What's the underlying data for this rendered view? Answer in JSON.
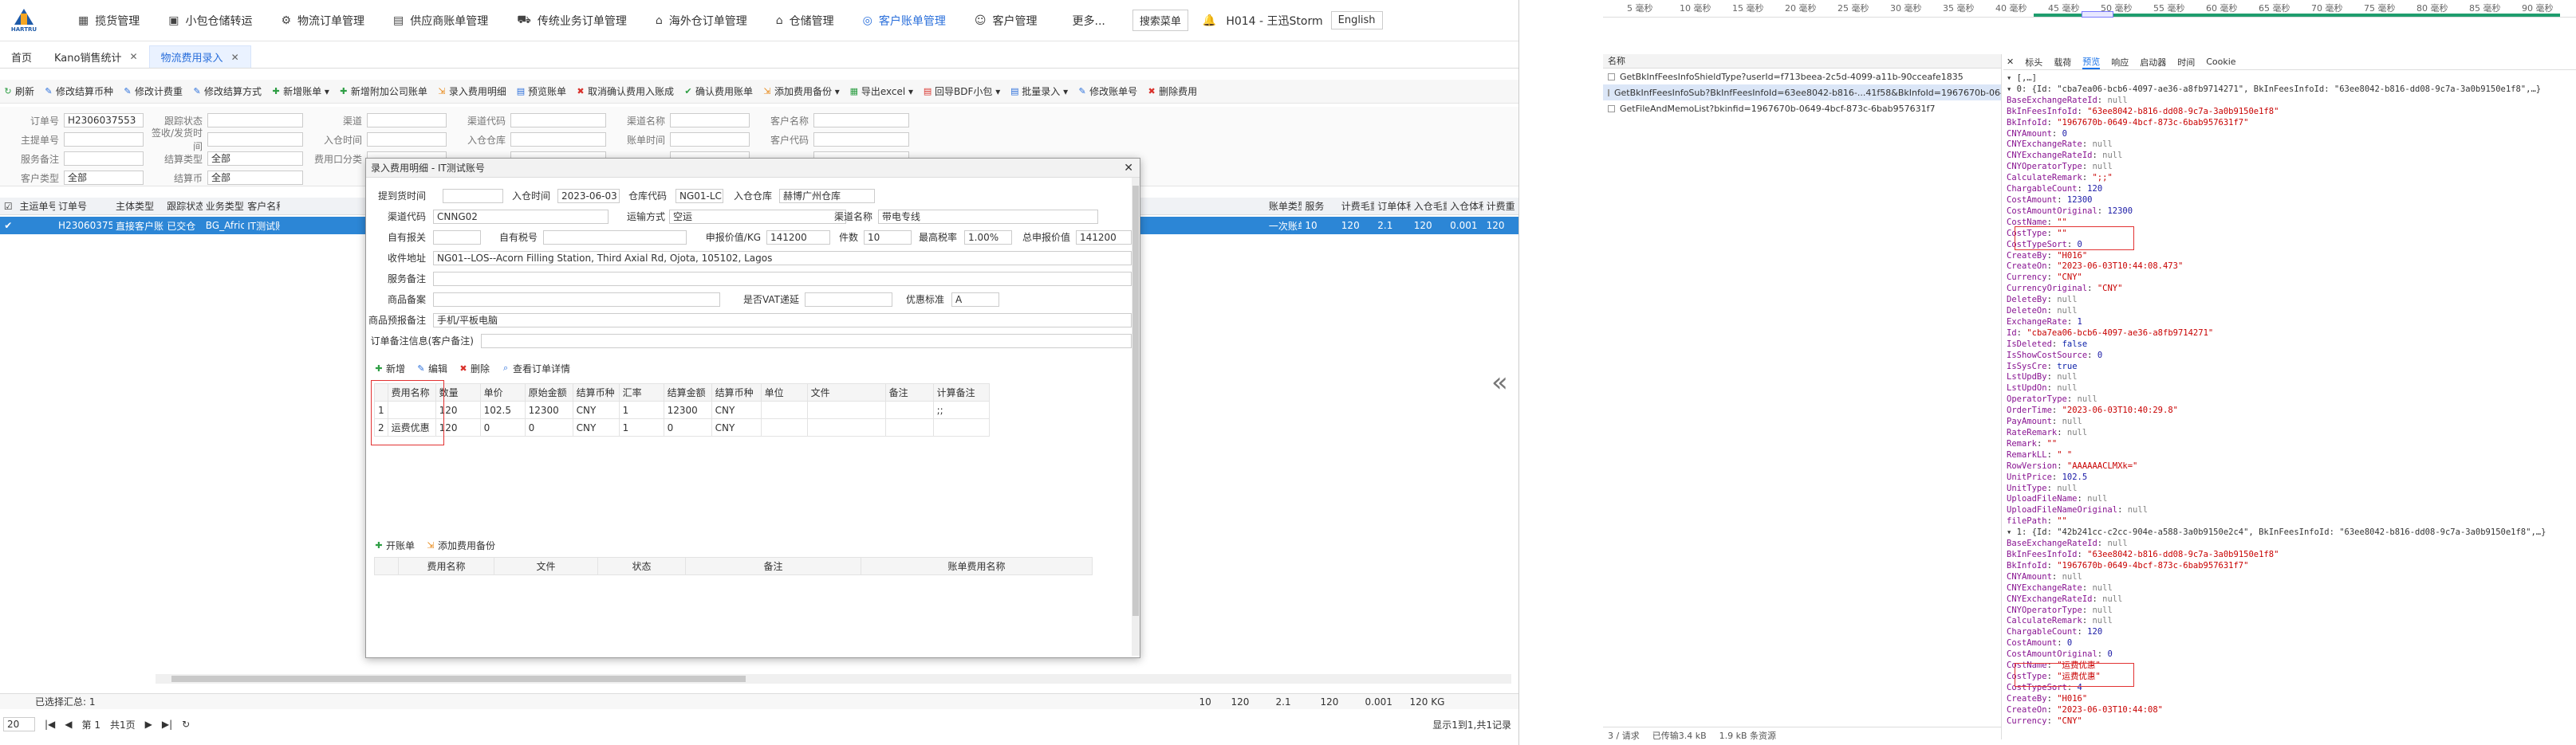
{
  "topnav": {
    "logo_text": "HARTRU",
    "items": [
      {
        "icon": "grid-icon",
        "label": "揽货管理"
      },
      {
        "icon": "warehouse-icon",
        "label": "小包仓储转运"
      },
      {
        "icon": "gear-icon",
        "label": "物流订单管理"
      },
      {
        "icon": "document-icon",
        "label": "供应商账单管理"
      },
      {
        "icon": "truck-icon",
        "label": "传统业务订单管理"
      },
      {
        "icon": "home-icon",
        "label": "海外仓订单管理"
      },
      {
        "icon": "house-icon",
        "label": "仓储管理"
      },
      {
        "icon": "compass-icon",
        "label": "客户账单管理"
      },
      {
        "icon": "users-icon",
        "label": "客户管理"
      },
      {
        "icon": "more-icon",
        "label": "更多..."
      }
    ],
    "active_index": 7,
    "search_menu": "搜索菜单",
    "bell": "bell-icon",
    "user": "H014 - 王迅Storm",
    "language": "English"
  },
  "tabs": [
    {
      "label": "首页"
    },
    {
      "label": "Kano销售统计",
      "close": "✕"
    },
    {
      "label": "物流费用录入",
      "close": "✕",
      "active": true
    }
  ],
  "toolbar": [
    {
      "icon": "refresh-icon",
      "label": "刷新"
    },
    {
      "icon": "edit-icon",
      "label": "修改结算币种"
    },
    {
      "icon": "edit-icon",
      "label": "修改计费重"
    },
    {
      "icon": "edit-icon",
      "label": "修改结算方式"
    },
    {
      "icon": "add-icon",
      "label": "新增账单 ▾"
    },
    {
      "icon": "add-icon",
      "label": "新增附加公司账单"
    },
    {
      "icon": "import-icon",
      "label": "录入费用明细"
    },
    {
      "icon": "preview-icon",
      "label": "预览账单"
    },
    {
      "icon": "cancel-icon",
      "label": "取消确认费用入账成"
    },
    {
      "icon": "check-icon",
      "label": "确认费用账单"
    },
    {
      "icon": "import-icon",
      "label": "添加费用备份 ▾"
    },
    {
      "icon": "excel-icon",
      "label": "导出excel ▾"
    },
    {
      "icon": "pdf-icon",
      "label": "回导BDF小包 ▾"
    },
    {
      "icon": "batch-icon",
      "label": "批量录入 ▾"
    },
    {
      "icon": "edit-icon",
      "label": "修改账单号"
    },
    {
      "icon": "delete-icon",
      "label": "删除费用"
    }
  ],
  "filters": {
    "row1": [
      {
        "label": "订单号",
        "value": "H2306037553"
      },
      {
        "label": "跟踪状态",
        "value": ""
      },
      {
        "label": "渠道",
        "value": ""
      },
      {
        "label": "渠道代码",
        "value": ""
      },
      {
        "label": "渠道名称",
        "value": ""
      },
      {
        "label": "客户名称",
        "value": ""
      }
    ],
    "row2": [
      {
        "label": "主提单号",
        "value": ""
      },
      {
        "label": "签收/发货时间",
        "value": ""
      },
      {
        "label": "入仓时间",
        "value": ""
      },
      {
        "label": "入仓仓库",
        "value": ""
      },
      {
        "label": "账单时间",
        "value": ""
      },
      {
        "label": "客户代码",
        "value": ""
      }
    ],
    "row3": [
      {
        "label": "服务备注",
        "value": ""
      },
      {
        "label": "结算类型",
        "value": "全部"
      },
      {
        "label": "费用口分类",
        "value": ""
      },
      {
        "label": "",
        "value": ""
      },
      {
        "label": "",
        "value": ""
      },
      {
        "label": "",
        "value": ""
      }
    ],
    "row4": [
      {
        "label": "客户类型",
        "value": "全部"
      },
      {
        "label": "结算币",
        "value": "全部"
      }
    ]
  },
  "grid": {
    "headers": [
      "主运单号",
      "订单号",
      "主体类型",
      "跟踪状态",
      "业务类型",
      "客户名称",
      "",
      "",
      "",
      "",
      "",
      "",
      "",
      "",
      "",
      "",
      "",
      "",
      "",
      "",
      "",
      "",
      "",
      "账单类型",
      "服务",
      "计费毛重",
      "订单体积",
      "入仓毛重",
      "入仓体积",
      "计费重"
    ],
    "row": [
      "",
      "H2306037553",
      "直接客户账单",
      "已交仓",
      "BG_Africa",
      "IT测试账",
      "",
      "",
      "",
      "",
      "",
      "",
      "",
      "",
      "",
      "",
      "",
      "",
      "",
      "",
      "",
      "",
      "",
      "一次账单",
      "10",
      "120",
      "2.1",
      "120",
      "0.001",
      "120"
    ],
    "footer_left": "已选择汇总: 1",
    "footer_vals": [
      "10",
      "120",
      "2.1",
      "120",
      "0.001",
      "120 KG"
    ],
    "page_size": "20",
    "page_label": "第 1",
    "page_total": "共1页",
    "status": "显示1到1,共1记录"
  },
  "dialog": {
    "title": "录入费用明细 - IT测试账号",
    "close": "✕",
    "fields": {
      "pickup_time_label": "提到货时间",
      "pickup_time": "",
      "warehouse_in_time_label": "入仓时间",
      "warehouse_in_time": "2023-06-03",
      "warehouse_code_label": "仓库代码",
      "warehouse_code": "NG01-LC",
      "in_warehouse_label": "入仓仓库",
      "in_warehouse": "赫博广州仓库",
      "channel_code_label": "渠道代码",
      "channel_code": "CNNG02",
      "transport_label": "运输方式",
      "transport": "空运",
      "channel_name_label": "渠道名称",
      "channel_name": "带电专线",
      "self_declare_label": "自有报关",
      "self_declare": "",
      "self_tax_label": "自有税号",
      "self_tax": "",
      "declare_value_label": "申报价值/KG",
      "declare_value": "141200",
      "pieces_label": "件数",
      "pieces": "10",
      "max_tax_label": "最高税率",
      "max_tax": "1.00%",
      "total_declare_label": "总申报价值",
      "total_declare": "141200",
      "address_label": "收件地址",
      "address": "NG01--LOS--Acorn Filling Station, Third Axial Rd, Ojota, 105102, Lagos",
      "service_note_label": "服务备注",
      "service_note": "",
      "goods_note_label": "商品备案",
      "goods_note": "",
      "vat_label": "是否VAT递延",
      "vat": "",
      "discount_label": "优惠标准",
      "discount": "A",
      "goods_remark_label": "商品预报备注",
      "goods_remark": "手机/平板电脑",
      "order_remark_label": "订单备注信息(客户备注)",
      "order_remark": ""
    },
    "sub_toolbar": [
      {
        "icon": "add-icon",
        "label": "新增"
      },
      {
        "icon": "edit-icon",
        "label": "编辑"
      },
      {
        "icon": "delete-icon",
        "label": "删除"
      },
      {
        "icon": "search-icon",
        "label": "查看订单详情"
      }
    ],
    "fee_headers": [
      "",
      "费用名称",
      "数量",
      "单价",
      "原始金额",
      "结算币种",
      "汇率",
      "结算金额",
      "结算币种",
      "单位",
      "文件",
      "备注",
      "计算备注"
    ],
    "fee_rows": [
      [
        "1",
        "",
        "120",
        "102.5",
        "12300",
        "CNY",
        "1",
        "12300",
        "CNY",
        "",
        "",
        "",
        ";;"
      ],
      [
        "2",
        "运费优惠",
        "120",
        "0",
        "0",
        "CNY",
        "1",
        "0",
        "CNY",
        "",
        "",
        "",
        ""
      ]
    ],
    "bill_toolbar": [
      {
        "icon": "add-icon",
        "label": "开账单"
      },
      {
        "icon": "import-icon",
        "label": "添加费用备份"
      }
    ],
    "bill_headers": [
      "",
      "费用名称",
      "文件",
      "状态",
      "备注",
      "账单费用名称"
    ]
  },
  "devtools": {
    "ticks": [
      "5 毫秒",
      "10 毫秒",
      "15 毫秒",
      "20 毫秒",
      "25 毫秒",
      "30 毫秒",
      "35 毫秒",
      "40 毫秒",
      "45 毫秒",
      "50 毫秒",
      "55 毫秒",
      "60 毫秒",
      "65 毫秒",
      "70 毫秒",
      "75 毫秒",
      "80 毫秒",
      "85 毫秒",
      "90 毫秒"
    ],
    "list_header": "名称",
    "requests": [
      "GetBkInfFeesInfoShieldType?userId=f713beea-2c5d-4099-a11b-90cceafe1835",
      "GetBkInfFeesInfoSub?BkInfFeesInfoId=63ee8042-b816-...41f58&BkInfoId=1967670b-0649-4bcf-873...",
      "GetFileAndMemoList?bkinfid=1967670b-0649-4bcf-873c-6bab957631f7"
    ],
    "selected_request": 1,
    "status": [
      "3 / 请求",
      "已传输3.4 kB",
      "1.9 kB 条资源"
    ],
    "detail_tabs": [
      "✕",
      "标头",
      "载荷",
      "预览",
      "响应",
      "启动器",
      "时间",
      "Cookie"
    ],
    "active_detail_tab": 3,
    "json_lines": [
      "▾ [,…]",
      "  ▾ 0: {Id: \"cba7ea06-bcb6-4097-ae36-a8fb9714271\", BkInFeesInfoId: \"63ee8042-b816-dd08-9c7a-3a0b9150e1f8\",…}",
      "    BaseExchangeRateId: null",
      "    BkInFeesInfoId: \"63ee8042-b816-dd08-9c7a-3a0b9150e1f8\"",
      "    BkInfoId: \"1967670b-0649-4bcf-873c-6bab957631f7\"",
      "    CNYAmount: 0",
      "    CNYExchangeRate: null",
      "    CNYExchangeRateId: null",
      "    CNYOperatorType: null",
      "    CalculateRemark: \";;\"",
      "    ChargableCount: 120",
      "    CostAmount: 12300",
      "    CostAmountOriginal: 12300",
      "    CostName: \"\"",
      "    CostType: \"\"",
      "    CostTypeSort: 0",
      "    CreateBy: \"H016\"",
      "    CreateOn: \"2023-06-03T10:44:08.473\"",
      "    Currency: \"CNY\"",
      "    CurrencyOriginal: \"CNY\"",
      "    DeleteBy: null",
      "    DeleteOn: null",
      "    ExchangeRate: 1",
      "    Id: \"cba7ea06-bcb6-4097-ae36-a8fb9714271\"",
      "    IsDeleted: false",
      "    IsShowCostSource: 0",
      "    IsSysCre: true",
      "    LstUpdBy: null",
      "    LstUpdOn: null",
      "    OperatorType: null",
      "    OrderTime: \"2023-06-03T10:40:29.8\"",
      "    PayAmount: null",
      "    RateRemark: null",
      "    Remark: \"\"",
      "    RemarkLL: \" \"",
      "    RowVersion: \"AAAAAACLMXk=\"",
      "    UnitPrice: 102.5",
      "    UnitType: null",
      "    UploadFileName: null",
      "    UploadFileNameOriginal: null",
      "    filePath: \"\"",
      "  ▾ 1: {Id: \"42b241cc-c2cc-904e-a588-3a0b9150e2c4\", BkInFeesInfoId: \"63ee8042-b816-dd08-9c7a-3a0b9150e1f8\",…}",
      "    BaseExchangeRateId: null",
      "    BkInFeesInfoId: \"63ee8042-b816-dd08-9c7a-3a0b9150e1f8\"",
      "    BkInfoId: \"1967670b-0649-4bcf-873c-6bab957631f7\"",
      "    CNYAmount: null",
      "    CNYExchangeRate: null",
      "    CNYExchangeRateId: null",
      "    CNYOperatorType: null",
      "    CalculateRemark: null",
      "    ChargableCount: 120",
      "    CostAmount: 0",
      "    CostAmountOriginal: 0",
      "    CostName: \"运费优惠\"",
      "    CostType: \"运费优惠\"",
      "    CostTypeSort: 4",
      "    CreateBy: \"H016\"",
      "    CreateOn: \"2023-06-03T10:44:08\"",
      "    Currency: \"CNY\""
    ]
  },
  "colors": {
    "accent": "#2a6fdb",
    "selected_row": "#2c86d6",
    "highlight_box": "#e23232"
  }
}
